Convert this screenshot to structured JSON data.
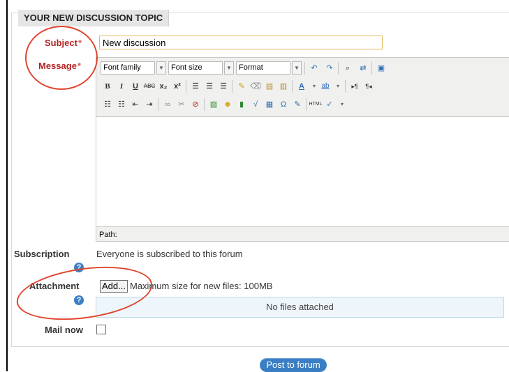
{
  "section": {
    "title": "YOUR NEW DISCUSSION TOPIC"
  },
  "subject": {
    "label": "Subject",
    "required_mark": "*",
    "value": "New discussion"
  },
  "message": {
    "label": "Message",
    "required_mark": "*",
    "toolbar": {
      "font_family": "Font family",
      "font_size": "Font size",
      "format": "Format"
    },
    "path_label": "Path:"
  },
  "subscription": {
    "label": "Subscription",
    "text": "Everyone is subscribed to this forum"
  },
  "attachment": {
    "label": "Attachment",
    "add_button": "Add...",
    "max_size_text": "Maximum size for new files: 100MB",
    "no_files_text": "No files attached"
  },
  "mail_now": {
    "label": "Mail now"
  },
  "submit": {
    "label": "Post to forum"
  },
  "help_glyph": "?",
  "colors": {
    "required": "#b32222",
    "accent": "#3a7fc3",
    "annotation": "#e0452e"
  }
}
